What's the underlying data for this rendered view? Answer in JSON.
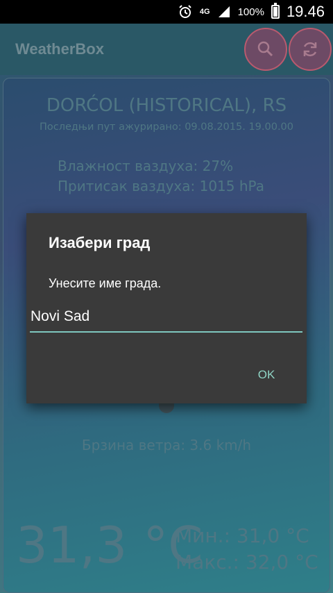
{
  "status_bar": {
    "network": "4G",
    "battery_percent": "100%",
    "time": "19.46",
    "icons": [
      "alarm-icon",
      "signal-icon",
      "battery-icon"
    ]
  },
  "app_bar": {
    "title": "WeatherBox",
    "icons": [
      "search-icon",
      "refresh-icon"
    ]
  },
  "weather": {
    "city": "DORĆOL (HISTORICAL), RS",
    "updated": "Последњи пут ажурирано: 09.08.2015. 19.00.00",
    "humidity": "Влажност ваздуха: 27%",
    "pressure": "Притисак ваздуха: 1015 hPa",
    "wind": "Брзина ветра: 3.6 km/h",
    "temperature": "31,3 °C",
    "min": "Мин.: 31,0 °C",
    "max": "Макс.: 32,0 °C"
  },
  "dialog": {
    "title": "Изабери град",
    "message": "Унесите име града.",
    "input_value": "Novi Sad",
    "ok_label": "OK"
  },
  "colors": {
    "accent": "#7fc8c0",
    "button_border": "#b95a6e",
    "dialog_bg": "#3a3a3a"
  }
}
